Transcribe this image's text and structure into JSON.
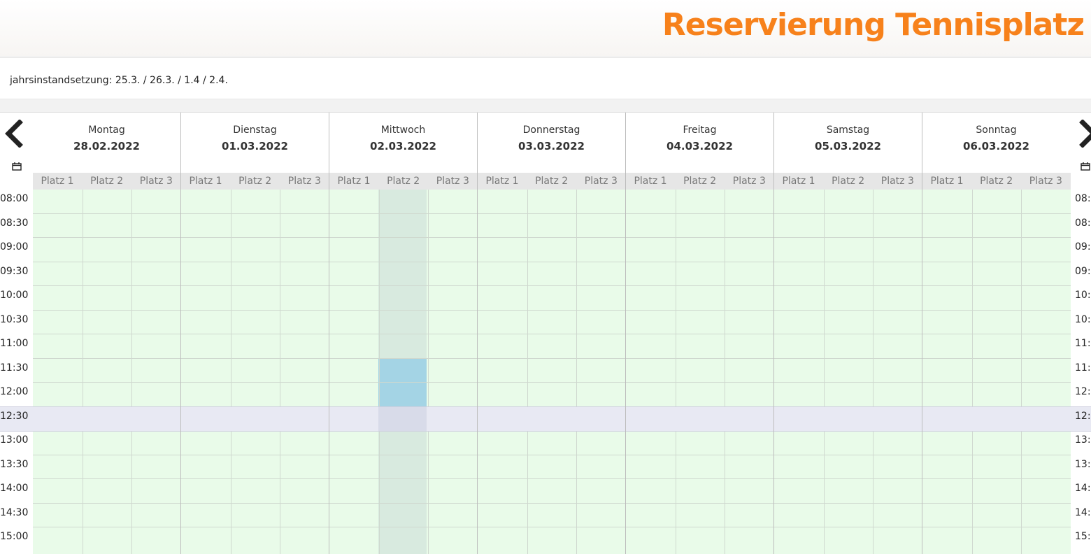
{
  "header": {
    "title": "Reservierung Tennisplatz"
  },
  "notice": {
    "text": "jahrsinstandsetzung: 25.3. / 26.3. / 1.4 / 2.4."
  },
  "calendar": {
    "prev_label": "‹",
    "next_label": "›",
    "days": [
      {
        "name": "Montag",
        "date": "28.02.2022"
      },
      {
        "name": "Dienstag",
        "date": "01.03.2022"
      },
      {
        "name": "Mittwoch",
        "date": "02.03.2022"
      },
      {
        "name": "Donnerstag",
        "date": "03.03.2022"
      },
      {
        "name": "Freitag",
        "date": "04.03.2022"
      },
      {
        "name": "Samstag",
        "date": "05.03.2022"
      },
      {
        "name": "Sonntag",
        "date": "06.03.2022"
      }
    ],
    "courts": [
      "Platz 1",
      "Platz 2",
      "Platz 3"
    ],
    "times": [
      "08:00",
      "08:30",
      "09:00",
      "09:30",
      "10:00",
      "10:30",
      "11:00",
      "11:30",
      "12:00",
      "12:30",
      "13:00",
      "13:30",
      "14:00",
      "14:30",
      "15:00"
    ],
    "times_right": [
      "08:",
      "08:",
      "09:",
      "09:",
      "10:",
      "10:",
      "11:",
      "11:",
      "12:",
      "12:",
      "13:",
      "13:",
      "14:",
      "14:",
      "15:"
    ],
    "booking": {
      "day": "Mittwoch",
      "court": "Platz 2",
      "start": "11:30",
      "end": "12:30"
    },
    "colors": {
      "free": "#e9fbe9",
      "booked": "#a4d4e5",
      "current_row": "#e8e9f3",
      "title": "#f7811b"
    }
  }
}
